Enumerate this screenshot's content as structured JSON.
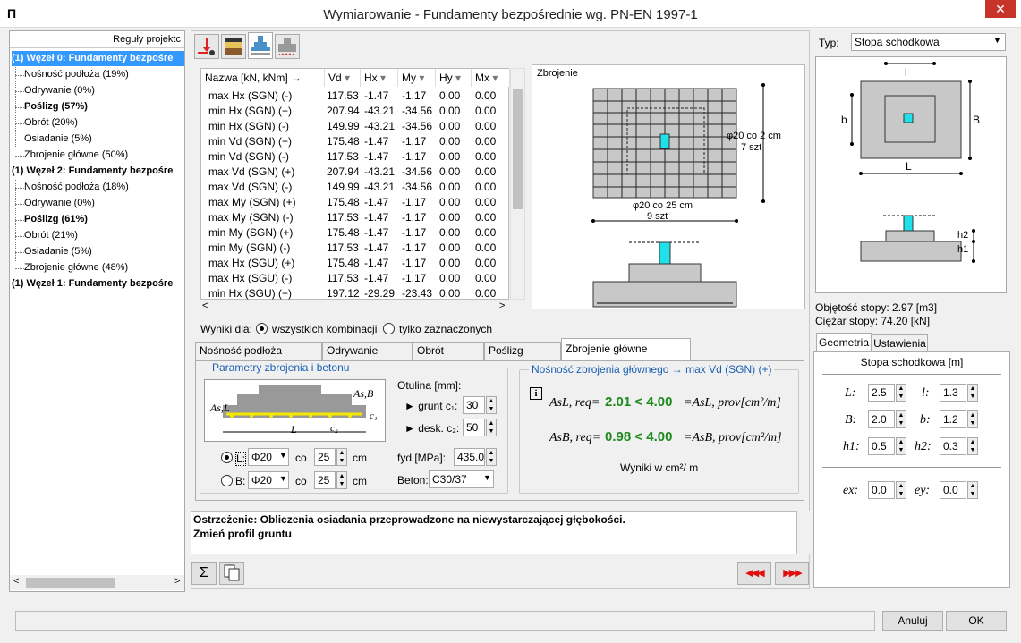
{
  "window": {
    "title": "Wymiarowanie - Fundamenty bezpośrednie wg. PN-EN 1997-1",
    "close": "✕",
    "icon": "Π"
  },
  "tree": {
    "header": "Reguły projektc",
    "items": [
      {
        "label": "(1) Węzeł 0: Fundamenty bezpośre",
        "level": 0,
        "style": "sel"
      },
      {
        "label": "Nośność podłoża (19%)",
        "level": 1,
        "style": ""
      },
      {
        "label": "Odrywanie (0%)",
        "level": 1,
        "style": ""
      },
      {
        "label": "Poślizg (57%)",
        "level": 1,
        "style": "bold"
      },
      {
        "label": "Obrót (20%)",
        "level": 1,
        "style": ""
      },
      {
        "label": "Osiadanie (5%)",
        "level": 1,
        "style": ""
      },
      {
        "label": "Zbrojenie główne (50%)",
        "level": 1,
        "style": ""
      },
      {
        "label": "(1) Węzeł 2: Fundamenty bezpośre",
        "level": 0,
        "style": "bold"
      },
      {
        "label": "Nośność podłoża (18%)",
        "level": 1,
        "style": ""
      },
      {
        "label": "Odrywanie (0%)",
        "level": 1,
        "style": ""
      },
      {
        "label": "Poślizg (61%)",
        "level": 1,
        "style": "bold"
      },
      {
        "label": "Obrót (21%)",
        "level": 1,
        "style": ""
      },
      {
        "label": "Osiadanie (5%)",
        "level": 1,
        "style": ""
      },
      {
        "label": "Zbrojenie główne (48%)",
        "level": 1,
        "style": ""
      },
      {
        "label": "(1) Węzeł 1: Fundamenty bezpośre",
        "level": 0,
        "style": "bold"
      }
    ],
    "scroll_left": "<",
    "scroll_right": ">"
  },
  "toolbar_icons": [
    "load-arrow-icon",
    "soil-layers-icon",
    "foundation-section-icon",
    "reinforcement-icon"
  ],
  "grid": {
    "columns": [
      "Nazwa  [kN, kNm] →",
      "Vd",
      "Hx",
      "My",
      "Hy",
      "Mx"
    ],
    "rows": [
      [
        "max Hx (SGN) (-)",
        "117.53",
        "-1.47",
        "-1.17",
        "0.00",
        "0.00"
      ],
      [
        "min Hx (SGN) (+)",
        "207.94",
        "-43.21",
        "-34.56",
        "0.00",
        "0.00"
      ],
      [
        "min Hx (SGN) (-)",
        "149.99",
        "-43.21",
        "-34.56",
        "0.00",
        "0.00"
      ],
      [
        "min Vd (SGN) (+)",
        "175.48",
        "-1.47",
        "-1.17",
        "0.00",
        "0.00"
      ],
      [
        "min Vd (SGN) (-)",
        "117.53",
        "-1.47",
        "-1.17",
        "0.00",
        "0.00"
      ],
      [
        "max Vd (SGN) (+)",
        "207.94",
        "-43.21",
        "-34.56",
        "0.00",
        "0.00"
      ],
      [
        "max Vd (SGN) (-)",
        "149.99",
        "-43.21",
        "-34.56",
        "0.00",
        "0.00"
      ],
      [
        "max My (SGN) (+)",
        "175.48",
        "-1.47",
        "-1.17",
        "0.00",
        "0.00"
      ],
      [
        "max My (SGN) (-)",
        "117.53",
        "-1.47",
        "-1.17",
        "0.00",
        "0.00"
      ],
      [
        "min My (SGN) (+)",
        "175.48",
        "-1.47",
        "-1.17",
        "0.00",
        "0.00"
      ],
      [
        "min My (SGN) (-)",
        "117.53",
        "-1.47",
        "-1.17",
        "0.00",
        "0.00"
      ],
      [
        "max Hx (SGU) (+)",
        "175.48",
        "-1.47",
        "-1.17",
        "0.00",
        "0.00"
      ],
      [
        "max Hx (SGU) (-)",
        "117.53",
        "-1.47",
        "-1.17",
        "0.00",
        "0.00"
      ],
      [
        "min Hx (SGU) (+)",
        "197.12",
        "-29.29",
        "-23.43",
        "0.00",
        "0.00"
      ]
    ]
  },
  "results_for": {
    "label": "Wyniki dla:",
    "opt_all": "wszystkich kombinacji",
    "opt_selected": "tylko zaznaczonych"
  },
  "drawing": {
    "title": "Zbrojenie",
    "rebar_right": "φ20 co 2 cm",
    "rebar_right_count": "7 szt",
    "rebar_bottom": "φ20 co 25 cm",
    "rebar_bottom_count": "9 szt"
  },
  "tabs": [
    "Nośność podłoża (19.0%)",
    "Odrywanie (0.0%)",
    "Obrót (20.3%)",
    "Poślizg (57.3%)",
    "Zbrojenie główne (50.2%)"
  ],
  "params": {
    "group_title": "Parametry zbrojenia i betonu",
    "cover_label": "Otulina [mm]:",
    "soil_label": "► grunt c₁:",
    "soil_value": "30",
    "board_label": "► desk. c₂:",
    "board_value": "50",
    "fyd_label": "fyd [MPa]:",
    "fyd_value": "435.0",
    "concrete_label": "Beton:",
    "concrete_value": "C30/37",
    "L_label": "L:",
    "L_bar": "Φ20",
    "L_co": "co",
    "L_spacing": "25",
    "L_unit": "cm",
    "B_label": "B:",
    "B_bar": "Φ20",
    "B_co": "co",
    "B_spacing": "25",
    "B_unit": "cm",
    "sketch_asl": "As,L",
    "sketch_asb": "As,B",
    "sketch_L": "L",
    "sketch_c1": "c₁",
    "sketch_c2": "c₂"
  },
  "capacity": {
    "group_title": "Nośność zbrojenia głównego → max Vd (SGN) (+)",
    "row1_lhs": "AsL, req=",
    "row1_val": "2.01 < 4.00",
    "row1_rhs": "=AsL, prov[cm²/m]",
    "row2_lhs": "AsB, req=",
    "row2_val": "0.98 < 4.00",
    "row2_rhs": "=AsB, prov[cm²/m]",
    "units_note": "Wyniki w  cm²/ m",
    "info_icon": "i"
  },
  "messages": {
    "line1": "Ostrzeżenie: Obliczenia osiadania przeprowadzone na niewystarczającej głębokości.",
    "line2": "Zmień profil gruntu"
  },
  "nav": {
    "sum": "Σ",
    "prev": "◀◀◀",
    "next": "▶▶▶"
  },
  "right": {
    "type_label": "Typ:",
    "type_value": "Stopa schodkowa",
    "dim_l": "l",
    "dim_b": "b",
    "dim_B": "B",
    "dim_L": "L",
    "dim_h1": "h1",
    "dim_h2": "h2",
    "volume": "Objętość stopy: 2.97 [m3]",
    "weight": "Ciężar stopy: 74.20 [kN]",
    "tab_geometry": "Geometria",
    "tab_settings": "Ustawienia",
    "geo_title": "Stopa schodkowa [m]",
    "L": "L:",
    "L_val": "2.5",
    "l": "l:",
    "l_val": "1.3",
    "B": "B:",
    "B_val": "2.0",
    "b": "b:",
    "b_val": "1.2",
    "h1": "h1:",
    "h1_val": "0.5",
    "h2": "h2:",
    "h2_val": "0.3",
    "ex": "ex:",
    "ex_val": "0.0",
    "ey": "ey:",
    "ey_val": "0.0"
  },
  "footer": {
    "cancel": "Anuluj",
    "ok": "OK"
  }
}
